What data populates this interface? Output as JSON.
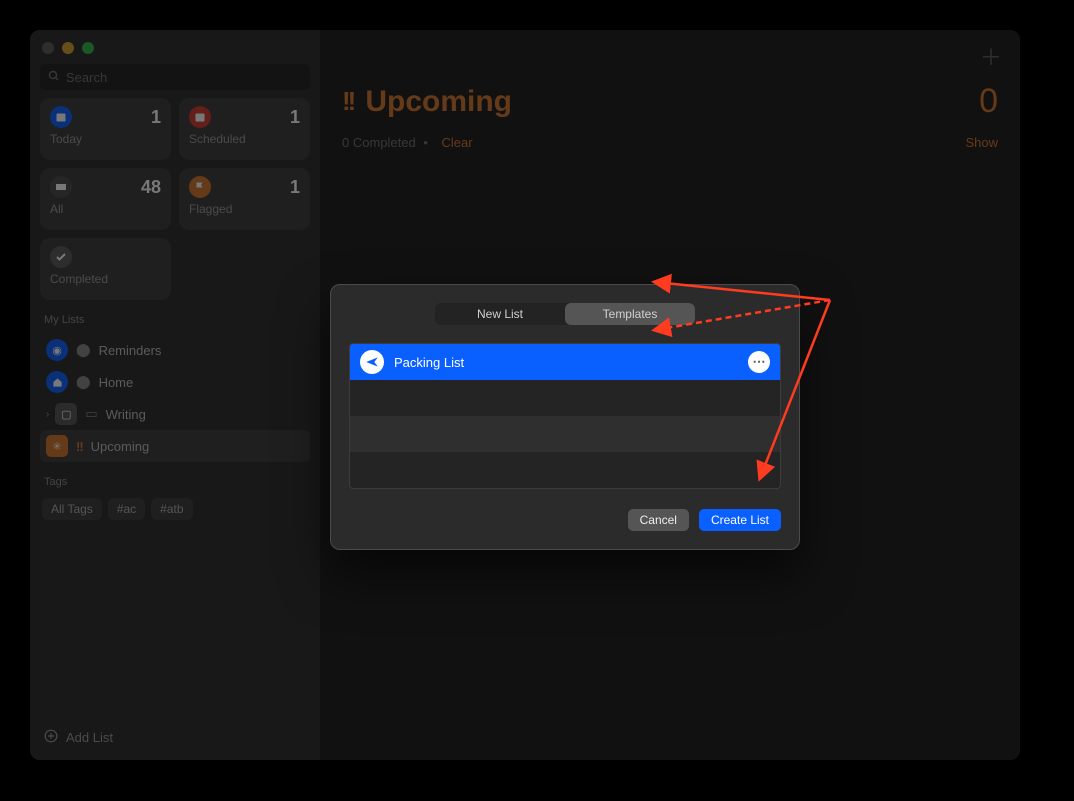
{
  "search": {
    "placeholder": "Search"
  },
  "smart": {
    "today": {
      "label": "Today",
      "count": "1"
    },
    "scheduled": {
      "label": "Scheduled",
      "count": "1"
    },
    "all": {
      "label": "All",
      "count": "48"
    },
    "flagged": {
      "label": "Flagged",
      "count": "1"
    },
    "completed": {
      "label": "Completed"
    }
  },
  "sidebar": {
    "mylists_label": "My Lists",
    "items": [
      {
        "label": "Reminders"
      },
      {
        "label": "Home"
      },
      {
        "label": "Writing"
      },
      {
        "label": "Upcoming"
      }
    ],
    "tags_label": "Tags",
    "tags": [
      {
        "label": "All Tags"
      },
      {
        "label": "#ac"
      },
      {
        "label": "#atb"
      }
    ],
    "add_list": "Add List"
  },
  "main": {
    "title": "Upcoming",
    "count": "0",
    "completed_text": "0 Completed",
    "dot": "•",
    "clear": "Clear",
    "show": "Show"
  },
  "modal": {
    "tab_new": "New List",
    "tab_templates": "Templates",
    "template_name": "Packing List",
    "cancel": "Cancel",
    "create": "Create List"
  }
}
